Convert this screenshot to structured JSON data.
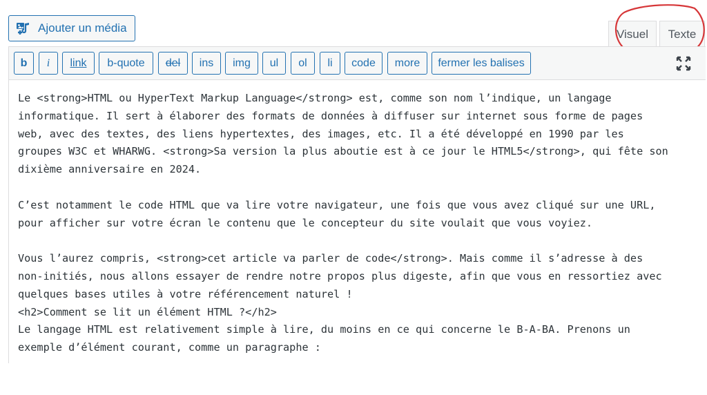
{
  "media_button": {
    "label": "Ajouter un média",
    "icon": "add-media-icon"
  },
  "tabs": {
    "visuel": "Visuel",
    "texte": "Texte"
  },
  "toolbar": {
    "buttons": [
      "b",
      "i",
      "link",
      "b-quote",
      "del",
      "ins",
      "img",
      "ul",
      "ol",
      "li",
      "code",
      "more",
      "fermer les balises"
    ],
    "fullscreen_icon": "expand-icon"
  },
  "editor": {
    "content": "Le <strong>HTML ou HyperText Markup Language</strong> est, comme son nom l’indique, un langage\ninformatique. Il sert à élaborer des formats de données à diffuser sur internet sous forme de pages\nweb, avec des textes, des liens hypertextes, des images, etc. Il a été développé en 1990 par les\ngroupes W3C et WHARWG. <strong>Sa version la plus aboutie est à ce jour le HTML5</strong>, qui fête son\ndixième anniversaire en 2024.\n\nC’est notamment le code HTML que va lire votre navigateur, une fois que vous avez cliqué sur une URL,\npour afficher sur votre écran le contenu que le concepteur du site voulait que vous voyiez.\n\nVous l’aurez compris, <strong>cet article va parler de code</strong>. Mais comme il s’adresse à des\nnon-initiés, nous allons essayer de rendre notre propos plus digeste, afin que vous en ressortiez avec\nquelques bases utiles à votre référencement naturel !\n<h2>Comment se lit un élément HTML ?</h2>\nLe langage HTML est relativement simple à lire, du moins en ce qui concerne le B-A-BA. Prenons un\nexemple d’élément courant, comme un paragraphe :"
  },
  "colors": {
    "accent": "#2271b1",
    "annotation": "#d63638",
    "toolbar_bg": "#f6f7f7",
    "border": "#dcdcde"
  }
}
